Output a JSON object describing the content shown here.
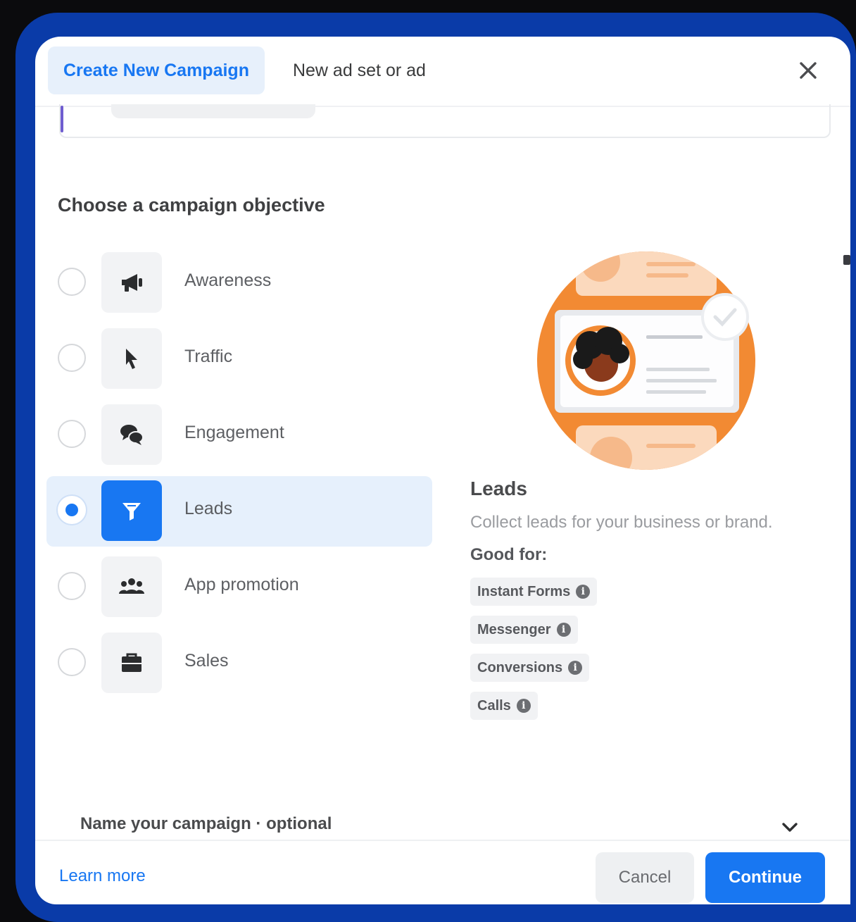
{
  "header": {
    "tabs": [
      {
        "label": "Create New Campaign",
        "active": true
      },
      {
        "label": "New ad set or ad",
        "active": false
      }
    ],
    "close_icon": "close-icon"
  },
  "objective": {
    "title": "Choose a campaign objective",
    "options": [
      {
        "label": "Awareness",
        "icon": "megaphone-icon",
        "selected": false
      },
      {
        "label": "Traffic",
        "icon": "cursor-icon",
        "selected": false
      },
      {
        "label": "Engagement",
        "icon": "chat-bubbles-icon",
        "selected": false
      },
      {
        "label": "Leads",
        "icon": "funnel-icon",
        "selected": true
      },
      {
        "label": "App promotion",
        "icon": "people-icon",
        "selected": false
      },
      {
        "label": "Sales",
        "icon": "briefcase-icon",
        "selected": false
      }
    ]
  },
  "detail": {
    "title": "Leads",
    "description": "Collect leads for your business or brand.",
    "good_for_label": "Good for:",
    "chips": [
      "Instant Forms",
      "Messenger",
      "Conversions",
      "Calls"
    ],
    "info_glyph": "i"
  },
  "name_section": {
    "label": "Name your campaign · optional"
  },
  "footer": {
    "learn_more": "Learn more",
    "cancel": "Cancel",
    "continue": "Continue"
  },
  "colors": {
    "accent": "#1877f2",
    "frame": "#0a3ba8",
    "illustration_orange": "#f28a33"
  }
}
